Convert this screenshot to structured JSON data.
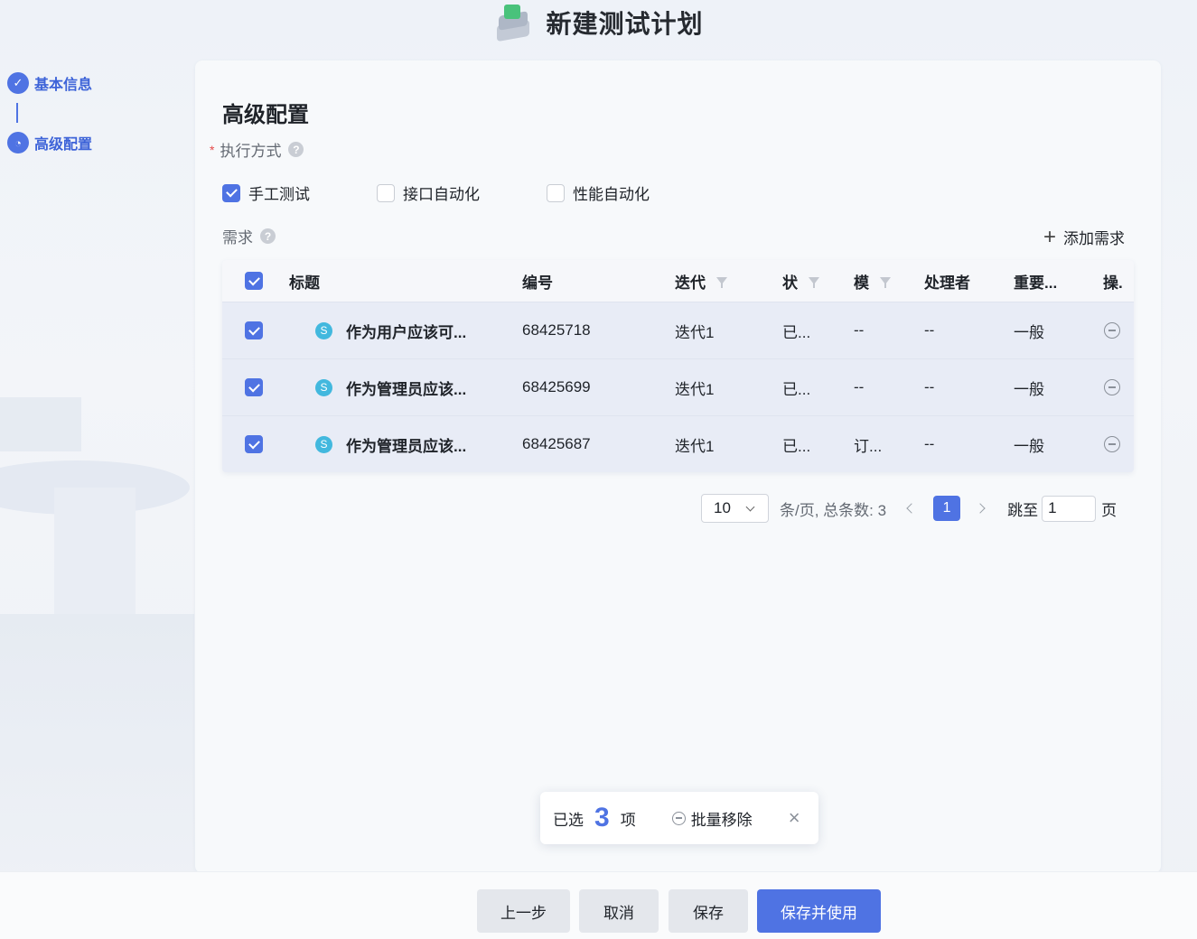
{
  "header": {
    "title": "新建测试计划",
    "logo_icon": "layers-icon"
  },
  "steps": [
    {
      "label": "基本信息",
      "status": "done"
    },
    {
      "label": "高级配置",
      "status": "current"
    }
  ],
  "section": {
    "title": "高级配置",
    "exec_label": "执行方式",
    "exec_options": [
      {
        "label": "手工测试",
        "checked": true
      },
      {
        "label": "接口自动化",
        "checked": false
      },
      {
        "label": "性能自动化",
        "checked": false
      }
    ],
    "req_label": "需求",
    "add_req": "添加需求"
  },
  "table": {
    "headers": {
      "title": "标题",
      "id": "编号",
      "iteration": "迭代",
      "status": "状",
      "module": "模",
      "handler": "处理者",
      "priority": "重要...",
      "ops": "操."
    },
    "rows": [
      {
        "badge": "S",
        "title": "作为用户应该可...",
        "id": "68425718",
        "iteration": "迭代1",
        "status": "已...",
        "module": "--",
        "handler": "--",
        "priority": "一般"
      },
      {
        "badge": "S",
        "title": "作为管理员应该...",
        "id": "68425699",
        "iteration": "迭代1",
        "status": "已...",
        "module": "--",
        "handler": "--",
        "priority": "一般"
      },
      {
        "badge": "S",
        "title": "作为管理员应该...",
        "id": "68425687",
        "iteration": "迭代1",
        "status": "已...",
        "module": "订...",
        "handler": "--",
        "priority": "一般"
      }
    ]
  },
  "pager": {
    "page_size": "10",
    "total_text": "条/页, 总条数: 3",
    "current_page": "1",
    "jump_label": "跳至",
    "jump_value": "1",
    "page_suffix": "页"
  },
  "selection_bar": {
    "prefix": "已选",
    "count": "3",
    "suffix": "项",
    "batch_remove": "批量移除",
    "close": "×"
  },
  "footer": {
    "prev": "上一步",
    "cancel": "取消",
    "save": "保存",
    "save_use": "保存并使用"
  },
  "colors": {
    "accent": "#4f73e3",
    "badge": "#42b8de",
    "required": "#e54a4a"
  }
}
